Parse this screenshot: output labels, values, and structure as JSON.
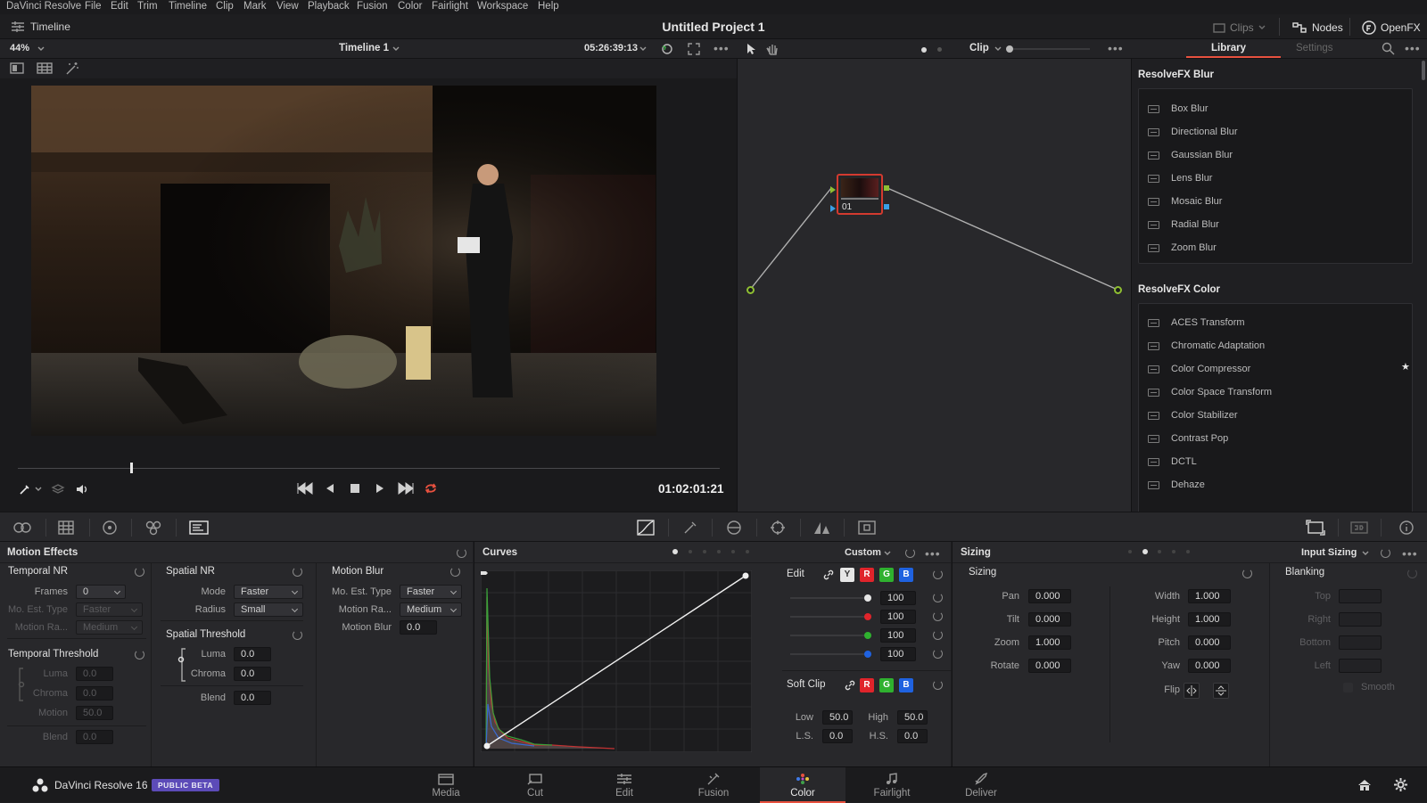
{
  "menu": {
    "app_name": "DaVinci Resolve",
    "items": [
      "File",
      "Edit",
      "Trim",
      "Timeline",
      "Clip",
      "Mark",
      "View",
      "Playback",
      "Fusion",
      "Color",
      "Fairlight",
      "Workspace",
      "Help"
    ]
  },
  "titlebar": {
    "timeline_label": "Timeline",
    "project_title": "Untitled Project 1",
    "clips_label": "Clips",
    "nodes_label": "Nodes",
    "openfx_label": "OpenFX"
  },
  "viewer": {
    "zoom": "44%",
    "timeline_name": "Timeline 1",
    "source_timecode": "05:26:39:13",
    "playhead_timecode": "01:02:01:21",
    "scrub_position": 0.16
  },
  "node_editor": {
    "mode": "Clip",
    "node_label": "01"
  },
  "library": {
    "tabs": [
      "Library",
      "Settings"
    ],
    "groups": [
      {
        "title": "ResolveFX Blur",
        "items": [
          "Box Blur",
          "Directional Blur",
          "Gaussian Blur",
          "Lens Blur",
          "Mosaic Blur",
          "Radial Blur",
          "Zoom Blur"
        ]
      },
      {
        "title": "ResolveFX Color",
        "items": [
          "ACES Transform",
          "Chromatic Adaptation",
          "Color Compressor",
          "Color Space Transform",
          "Color Stabilizer",
          "Contrast Pop",
          "DCTL",
          "Dehaze"
        ]
      }
    ],
    "starred_item": "Color Compressor"
  },
  "motion_effects": {
    "title": "Motion Effects",
    "temporal_nr": {
      "title": "Temporal NR",
      "frames_label": "Frames",
      "frames": "0",
      "mo_est_type_label": "Mo. Est. Type",
      "mo_est_type": "Faster",
      "motion_range_label": "Motion Ra...",
      "motion_range": "Medium"
    },
    "temporal_threshold": {
      "title": "Temporal Threshold",
      "luma_label": "Luma",
      "luma": "0.0",
      "chroma_label": "Chroma",
      "chroma": "0.0",
      "motion_label": "Motion",
      "motion": "50.0",
      "blend_label": "Blend",
      "blend": "0.0"
    },
    "spatial_nr": {
      "title": "Spatial NR",
      "mode_label": "Mode",
      "mode": "Faster",
      "radius_label": "Radius",
      "radius": "Small"
    },
    "spatial_threshold": {
      "title": "Spatial Threshold",
      "luma_label": "Luma",
      "luma": "0.0",
      "chroma_label": "Chroma",
      "chroma": "0.0",
      "blend_label": "Blend",
      "blend": "0.0"
    },
    "motion_blur": {
      "title": "Motion Blur",
      "mo_est_type_label": "Mo. Est. Type",
      "mo_est_type": "Faster",
      "motion_range_label": "Motion Ra...",
      "motion_range": "Medium",
      "motion_blur_label": "Motion Blur",
      "motion_blur": "0.0"
    }
  },
  "curves": {
    "title": "Curves",
    "preset": "Custom",
    "edit_label": "Edit",
    "channels": [
      {
        "key": "Y",
        "value": "100",
        "color": "#e8e8e8"
      },
      {
        "key": "R",
        "value": "100",
        "color": "#e0242b"
      },
      {
        "key": "G",
        "value": "100",
        "color": "#2fb12f"
      },
      {
        "key": "B",
        "value": "100",
        "color": "#1f62e0"
      }
    ],
    "soft_clip_label": "Soft Clip",
    "low_label": "Low",
    "low": "50.0",
    "high_label": "High",
    "high": "50.0",
    "ls_label": "L.S.",
    "ls": "0.0",
    "hs_label": "H.S.",
    "hs": "0.0"
  },
  "sizing": {
    "title": "Sizing",
    "mode": "Input Sizing",
    "section": "Sizing",
    "pan_label": "Pan",
    "pan": "0.000",
    "tilt_label": "Tilt",
    "tilt": "0.000",
    "zoom_label": "Zoom",
    "zoom": "1.000",
    "rotate_label": "Rotate",
    "rotate": "0.000",
    "width_label": "Width",
    "width": "1.000",
    "height_label": "Height",
    "height": "1.000",
    "pitch_label": "Pitch",
    "pitch": "0.000",
    "yaw_label": "Yaw",
    "yaw": "0.000",
    "flip_label": "Flip",
    "blanking": {
      "title": "Blanking",
      "top_label": "Top",
      "right_label": "Right",
      "bottom_label": "Bottom",
      "left_label": "Left",
      "smooth_label": "Smooth"
    }
  },
  "bottom_bar": {
    "brand": "DaVinci Resolve 16",
    "badge": "PUBLIC BETA",
    "pages": [
      {
        "label": "Media"
      },
      {
        "label": "Cut"
      },
      {
        "label": "Edit"
      },
      {
        "label": "Fusion"
      },
      {
        "label": "Color"
      },
      {
        "label": "Fairlight"
      },
      {
        "label": "Deliver"
      }
    ],
    "active_page": "Color"
  },
  "colors": {
    "accent": "#e8513f",
    "badge": "#5c4bb8",
    "node_border": "#d33a2f",
    "node_link": "#b0b0b0"
  }
}
